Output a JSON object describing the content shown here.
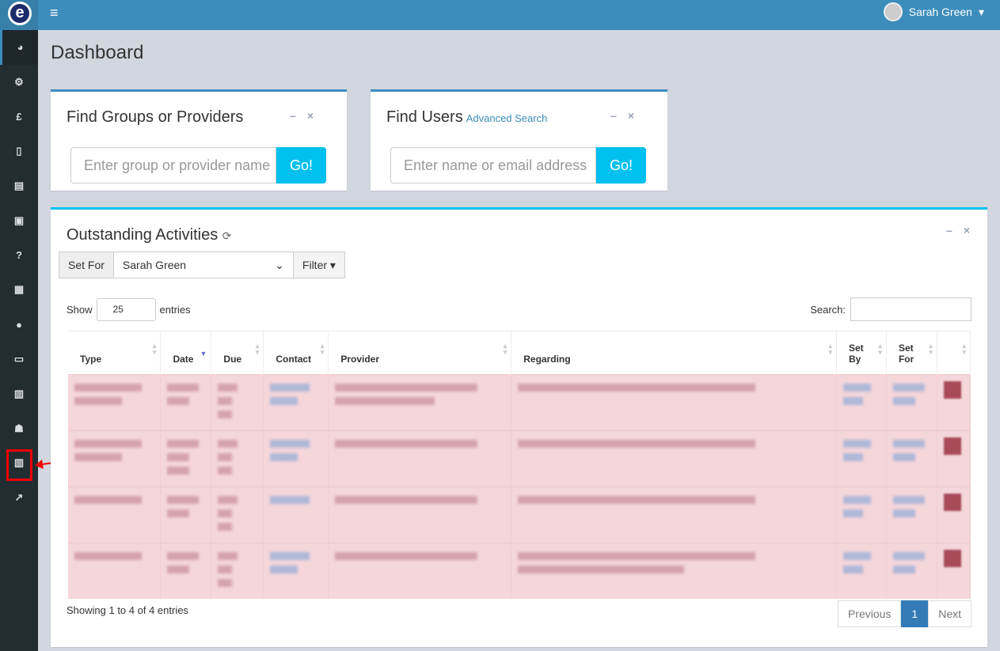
{
  "header": {
    "logo_letter": "e",
    "user_name": "Sarah Green"
  },
  "sidebar": {
    "items": [
      "dashboard-icon",
      "cogs-icon",
      "pound-icon",
      "file-icon",
      "list-icon",
      "object-group-icon",
      "question-icon",
      "calendar-icon",
      "map-marker-icon",
      "money-icon",
      "building-icon",
      "user-icon",
      "building-alt-icon",
      "external-link-icon"
    ]
  },
  "page": {
    "title": "Dashboard"
  },
  "find_groups": {
    "title": "Find Groups or Providers",
    "placeholder": "Enter group or provider name",
    "go": "Go!"
  },
  "find_users": {
    "title": "Find Users",
    "advanced": "Advanced Search",
    "placeholder": "Enter name or email address",
    "go": "Go!"
  },
  "activities": {
    "title": "Outstanding Activities",
    "set_for_label": "Set For",
    "set_for_value": "Sarah Green",
    "filter": "Filter",
    "show": "Show",
    "entries_value": "25",
    "entries": "entries",
    "search_label": "Search:",
    "columns": [
      "Type",
      "Date",
      "Due",
      "Contact",
      "Provider",
      "Regarding",
      "Set By",
      "Set For",
      ""
    ],
    "info": "Showing 1 to 4 of 4 entries",
    "pagination": {
      "previous": "Previous",
      "page": "1",
      "next": "Next"
    }
  }
}
